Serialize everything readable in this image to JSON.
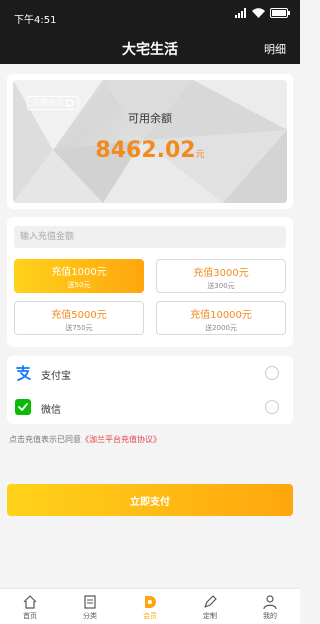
{
  "status_bar": {
    "time": "下午4:51"
  },
  "nav": {
    "title": "大宅生活",
    "right_label": "明细"
  },
  "balance": {
    "badge": "白银会员",
    "label": "可用余额",
    "amount": "8462.02",
    "unit": "元"
  },
  "recharge": {
    "placeholder": "输入充值金额",
    "options": [
      {
        "main": "充值1000元",
        "sub": "送50元",
        "selected": true
      },
      {
        "main": "充值3000元",
        "sub": "送300元",
        "selected": false
      },
      {
        "main": "充值5000元",
        "sub": "送750元",
        "selected": false
      },
      {
        "main": "充值10000元",
        "sub": "送2000元",
        "selected": false
      }
    ]
  },
  "payment": {
    "methods": [
      {
        "label": "支付宝",
        "icon": "alipay-icon",
        "selected": false
      },
      {
        "label": "微信",
        "icon": "wechat-icon",
        "selected": false
      }
    ]
  },
  "agreement": {
    "prefix": "点击充值表示已同意",
    "link": "《泇兰平台充值协议》"
  },
  "pay_button": {
    "label": "立即支付"
  },
  "tabs": [
    {
      "label": "首页",
      "icon": "home-icon",
      "active": false
    },
    {
      "label": "分类",
      "icon": "category-icon",
      "active": false
    },
    {
      "label": "会员",
      "icon": "member-icon",
      "active": true
    },
    {
      "label": "定制",
      "icon": "customize-icon",
      "active": false
    },
    {
      "label": "我的",
      "icon": "profile-icon",
      "active": false
    }
  ],
  "colors": {
    "accent": "#ffa60e",
    "accent_light": "#ffd21a",
    "amount_text": "#f08c1e",
    "link": "#e64545",
    "alipay": "#1677ff",
    "wechat": "#09bb07"
  }
}
